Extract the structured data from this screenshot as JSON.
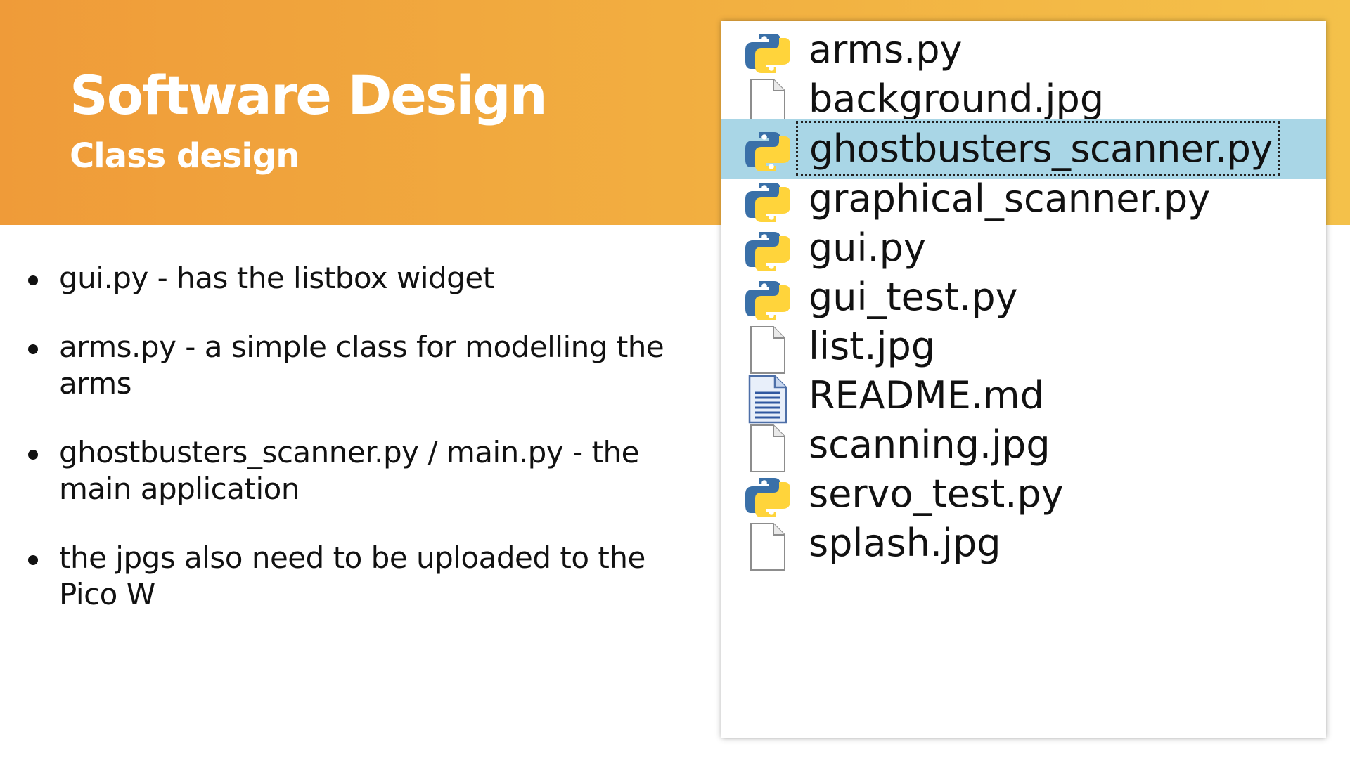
{
  "header": {
    "title": "Software Design",
    "subtitle": "Class design"
  },
  "bullets": [
    {
      "line1": "gui.py - has the listbox widget",
      "line2": ""
    },
    {
      "line1": "arms.py - a simple class for modelling the",
      "line2": "arms"
    },
    {
      "line1": "ghostbusters_scanner.py / main.py - the",
      "line2": "main application"
    },
    {
      "line1": "the jpgs also need to be uploaded to the",
      "line2": "Pico W"
    }
  ],
  "file_list": {
    "selected": "ghostbusters_scanner.py",
    "items": [
      {
        "name": "arms.py",
        "icon": "python-file-icon"
      },
      {
        "name": "background.jpg",
        "icon": "blank-file-icon"
      },
      {
        "name": "ghostbusters_scanner.py",
        "icon": "python-file-icon"
      },
      {
        "name": "graphical_scanner.py",
        "icon": "python-file-icon"
      },
      {
        "name": "gui.py",
        "icon": "python-file-icon"
      },
      {
        "name": "gui_test.py",
        "icon": "python-file-icon"
      },
      {
        "name": "list.jpg",
        "icon": "blank-file-icon"
      },
      {
        "name": "README.md",
        "icon": "text-document-icon"
      },
      {
        "name": "scanning.jpg",
        "icon": "blank-file-icon"
      },
      {
        "name": "servo_test.py",
        "icon": "python-file-icon"
      },
      {
        "name": "splash.jpg",
        "icon": "blank-file-icon"
      }
    ]
  },
  "colors": {
    "banner_left": "#ef9b39",
    "banner_right": "#f4c14a",
    "selection": "#a9d6e6",
    "python_blue": "#3a70a8",
    "python_yellow": "#ffd43b"
  }
}
